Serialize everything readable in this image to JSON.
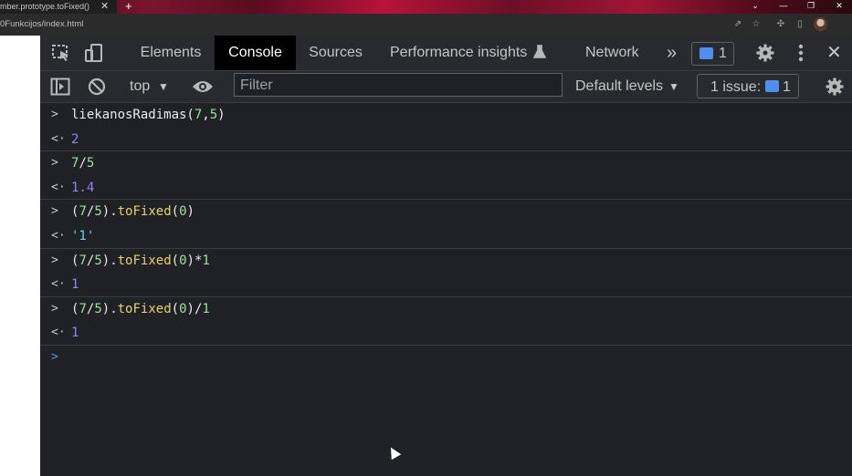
{
  "browser": {
    "tab_title": "mber.prototype.toFixed() - Jav",
    "tab_close": "✕",
    "new_tab": "+",
    "url": "0Funkcijos/index.html"
  },
  "devtools": {
    "tabs": [
      "Elements",
      "Console",
      "Sources",
      "Performance insights",
      "Network"
    ],
    "active_tab": "Console",
    "more_tabs": "»",
    "messages_count": "1",
    "close": "✕"
  },
  "toolbar": {
    "context": "top",
    "filter_placeholder": "Filter",
    "levels": "Default levels",
    "issues_label": "1 issue:",
    "issues_count": "1"
  },
  "console": {
    "entries": [
      {
        "input": "liekanosRadimas(7,5)",
        "output": "2"
      },
      {
        "input": "7/5",
        "output": "1.4"
      },
      {
        "input": "(7/5).toFixed(0)",
        "output": "'1'"
      },
      {
        "input": "(7/5).toFixed(0)*1",
        "output": "1"
      },
      {
        "input": "(7/5).toFixed(0)/1",
        "output": "1"
      }
    ],
    "prompt_symbol": ">",
    "result_symbol": "<·"
  }
}
